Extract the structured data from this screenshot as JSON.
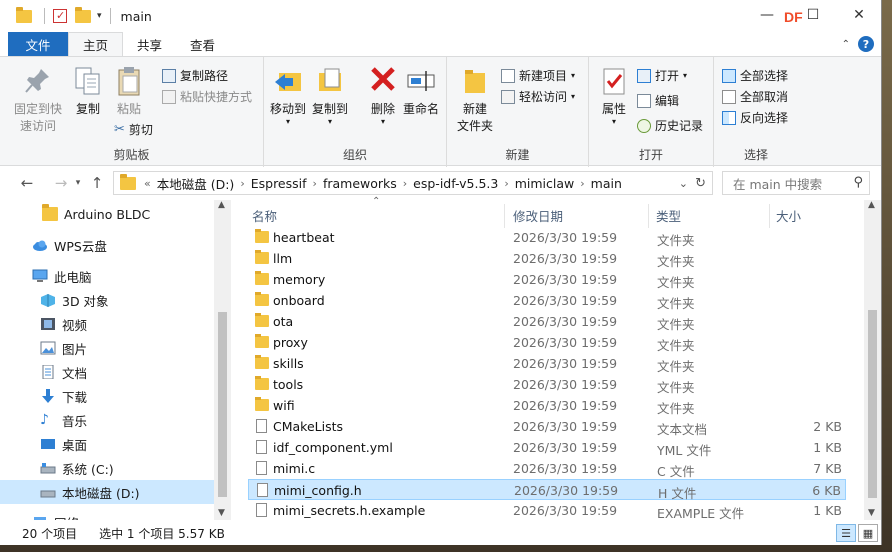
{
  "window": {
    "title": "main",
    "watermark": "DF"
  },
  "tabs": {
    "file": "文件",
    "home": "主页",
    "share": "共享",
    "view": "查看"
  },
  "ribbon": {
    "clipboard": {
      "label": "剪贴板",
      "pin": "固定到快\n速访问",
      "copy": "复制",
      "paste": "粘贴",
      "copy_path": "复制路径",
      "paste_shortcut": "粘贴快捷方式",
      "cut": "剪切"
    },
    "organize": {
      "label": "组织",
      "move_to": "移动到",
      "copy_to": "复制到",
      "delete": "删除",
      "rename": "重命名"
    },
    "new": {
      "label": "新建",
      "new_folder": "新建\n文件夹",
      "new_item": "新建项目",
      "easy_access": "轻松访问"
    },
    "open": {
      "label": "打开",
      "properties": "属性",
      "open": "打开",
      "edit": "编辑",
      "history": "历史记录"
    },
    "select": {
      "label": "选择",
      "select_all": "全部选择",
      "select_none": "全部取消",
      "invert": "反向选择"
    }
  },
  "address": {
    "prefix": "«",
    "crumbs": [
      "本地磁盘 (D:)",
      "Espressif",
      "frameworks",
      "esp-idf-v5.5.3",
      "mimiclaw",
      "main"
    ],
    "search_placeholder": "在 main 中搜索"
  },
  "nav": [
    {
      "label": "Arduino  BLDC",
      "icon": "folder-icon"
    },
    {
      "label": "WPS云盘",
      "icon": "cloud-icon"
    },
    {
      "label": "此电脑",
      "icon": "computer-icon"
    },
    {
      "label": "3D 对象",
      "icon": "cube-icon"
    },
    {
      "label": "视频",
      "icon": "video-icon"
    },
    {
      "label": "图片",
      "icon": "picture-icon"
    },
    {
      "label": "文档",
      "icon": "document-icon"
    },
    {
      "label": "下载",
      "icon": "download-icon"
    },
    {
      "label": "音乐",
      "icon": "music-icon"
    },
    {
      "label": "桌面",
      "icon": "desktop-icon"
    },
    {
      "label": "系统 (C:)",
      "icon": "drive-icon"
    },
    {
      "label": "本地磁盘 (D:)",
      "icon": "drive-icon"
    },
    {
      "label": "网络",
      "icon": "network-icon"
    }
  ],
  "columns": {
    "name": "名称",
    "date": "修改日期",
    "type": "类型",
    "size": "大小"
  },
  "files": [
    {
      "name": "heartbeat",
      "date": "2026/3/30 19:59",
      "type": "文件夹",
      "size": "",
      "kind": "folder"
    },
    {
      "name": "llm",
      "date": "2026/3/30 19:59",
      "type": "文件夹",
      "size": "",
      "kind": "folder"
    },
    {
      "name": "memory",
      "date": "2026/3/30 19:59",
      "type": "文件夹",
      "size": "",
      "kind": "folder"
    },
    {
      "name": "onboard",
      "date": "2026/3/30 19:59",
      "type": "文件夹",
      "size": "",
      "kind": "folder"
    },
    {
      "name": "ota",
      "date": "2026/3/30 19:59",
      "type": "文件夹",
      "size": "",
      "kind": "folder"
    },
    {
      "name": "proxy",
      "date": "2026/3/30 19:59",
      "type": "文件夹",
      "size": "",
      "kind": "folder"
    },
    {
      "name": "skills",
      "date": "2026/3/30 19:59",
      "type": "文件夹",
      "size": "",
      "kind": "folder"
    },
    {
      "name": "tools",
      "date": "2026/3/30 19:59",
      "type": "文件夹",
      "size": "",
      "kind": "folder"
    },
    {
      "name": "wifi",
      "date": "2026/3/30 19:59",
      "type": "文件夹",
      "size": "",
      "kind": "folder"
    },
    {
      "name": "CMakeLists",
      "date": "2026/3/30 19:59",
      "type": "文本文档",
      "size": "2 KB",
      "kind": "file"
    },
    {
      "name": "idf_component.yml",
      "date": "2026/3/30 19:59",
      "type": "YML 文件",
      "size": "1 KB",
      "kind": "file"
    },
    {
      "name": "mimi.c",
      "date": "2026/3/30 19:59",
      "type": "C 文件",
      "size": "7 KB",
      "kind": "file"
    },
    {
      "name": "mimi_config.h",
      "date": "2026/3/30 19:59",
      "type": "H 文件",
      "size": "6 KB",
      "kind": "file",
      "selected": true
    },
    {
      "name": "mimi_secrets.h.example",
      "date": "2026/3/30 19:59",
      "type": "EXAMPLE 文件",
      "size": "1 KB",
      "kind": "file"
    }
  ],
  "status": {
    "count": "20 个项目",
    "selection": "选中 1 个项目  5.57 KB"
  },
  "colors": {
    "accent": "#1f6dbf",
    "selection": "#cce8ff",
    "folder": "#f4c542"
  }
}
